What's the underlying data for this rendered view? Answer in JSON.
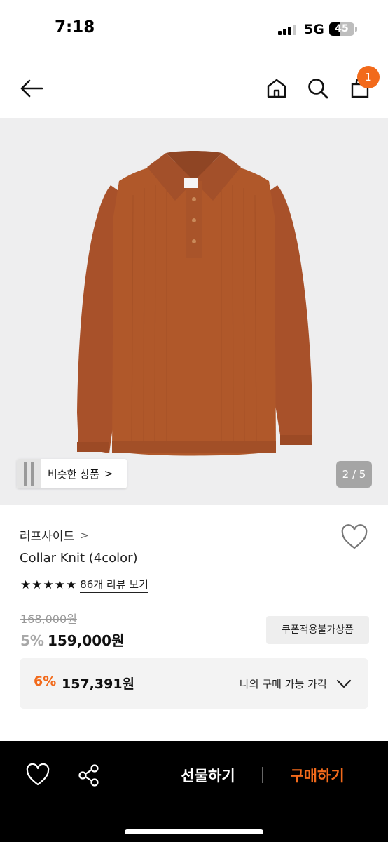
{
  "status_bar": {
    "time": "7:18",
    "network": "5G",
    "battery_level": "45",
    "signal_bars": 3
  },
  "header": {
    "back_icon": "arrow-left-icon",
    "home_icon": "home-icon",
    "search_icon": "search-icon",
    "cart_icon": "shopping-bag-icon",
    "cart_badge": "1"
  },
  "gallery": {
    "similar_label": "비슷한 상품",
    "similar_chevron": ">",
    "page_indicator": "2 / 5",
    "image_description_icon": "sweater-product-image"
  },
  "product": {
    "brand": "러프사이드",
    "brand_chevron": ">",
    "name": "Collar Knit (4color)",
    "rating_stars": 5,
    "review_link": "86개 리뷰 보기",
    "original_price": "168,000원",
    "discount_rate": "5%",
    "sale_price": "159,000원",
    "coupon_badge": "쿠폰적용불가상품"
  },
  "my_price": {
    "discount_rate": "6%",
    "price": "157,391원",
    "label": "나의 구매 가능 가격"
  },
  "bottom_bar": {
    "gift_label": "선물하기",
    "buy_label": "구매하기"
  },
  "colors": {
    "accent": "#f26a1b",
    "sweater": "#b0582a",
    "image_bg": "#eeeeef"
  }
}
